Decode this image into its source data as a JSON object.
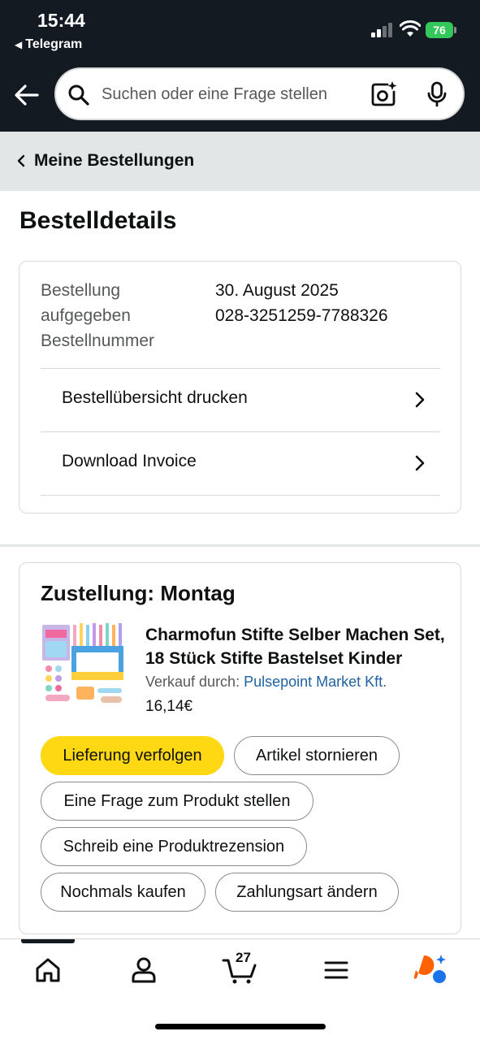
{
  "status_bar": {
    "time": "15:44",
    "back_app": "Telegram",
    "battery": "76"
  },
  "search": {
    "placeholder": "Suchen oder eine Frage stellen"
  },
  "breadcrumb": {
    "label": "Meine Bestellungen"
  },
  "page_title": "Bestelldetails",
  "order_summary": {
    "label_placed_line1": "Bestellung",
    "label_placed_line2": "aufgegeben",
    "label_number": "Bestellnummer",
    "date": "30. August 2025",
    "number": "028-3251259-7788326",
    "links": [
      {
        "label": "Bestellübersicht drucken"
      },
      {
        "label": "Download Invoice"
      }
    ]
  },
  "shipment": {
    "heading": "Zustellung: Montag",
    "product_name": "Charmofun Stifte Selber Machen Set, 18 Stück Stifte Bastelset Kinder",
    "seller_prefix": "Verkauf durch: ",
    "seller_name": "Pulsepoint Market Kft.",
    "price": "16,14€",
    "actions": [
      "Lieferung verfolgen",
      "Artikel stornieren",
      "Eine Frage zum Produkt stellen",
      "Schreib eine Produktrezension",
      "Nochmals kaufen",
      "Zahlungsart ändern"
    ]
  },
  "bottom_nav": {
    "cart_count": "27",
    "items": [
      "home-icon",
      "account-icon",
      "cart-icon",
      "menu-icon",
      "rufus-icon"
    ]
  },
  "colors": {
    "header_bg": "#131a22",
    "breadcrumb_bg": "#e3e6e6",
    "primary_button": "#ffd814",
    "link": "#2162a1",
    "battery": "#34c759",
    "assistant_orange": "#ff6200",
    "assistant_blue": "#1a73e8"
  }
}
